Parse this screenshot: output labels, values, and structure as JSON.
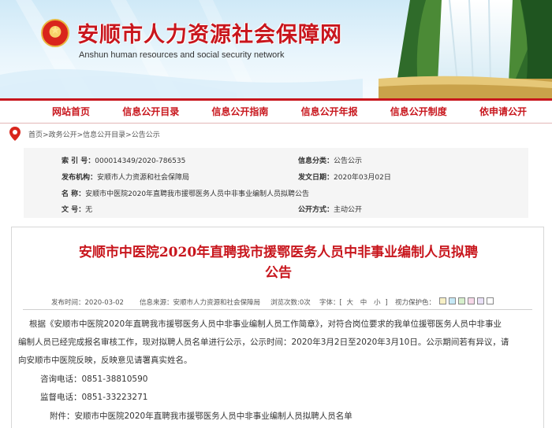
{
  "header": {
    "site_title": "安顺市人力资源社会保障网",
    "site_subtitle": "Anshun human resources and social security network"
  },
  "nav": {
    "items": [
      "网站首页",
      "信息公开目录",
      "信息公开指南",
      "信息公开年报",
      "信息公开制度",
      "依申请公开"
    ]
  },
  "breadcrumb": [
    "首页",
    "政务公开",
    "信息公开目录",
    "公告公示"
  ],
  "meta": {
    "index_label": "索  引  号：",
    "index_value": "000014349/2020-786535",
    "category_label": "信息分类：",
    "category_value": "公告公示",
    "org_label": "发布机构：",
    "org_value": "安顺市人力资源和社会保障局",
    "date_label": "发文日期：",
    "date_value": "2020年03月02日",
    "name_label": "名        称：",
    "name_value": "安顺市中医院2020年直聘我市援鄂医务人员中非事业编制人员拟聘公告",
    "doc_label": "文        号：",
    "doc_value": "无",
    "mode_label": "公开方式：",
    "mode_value": "主动公开"
  },
  "article": {
    "title_line1": "安顺市中医院2020年直聘我市援鄂医务人员中非事业编制人员拟聘",
    "title_line2": "公告",
    "publish_time": "发布时间：2020-03-02",
    "source": "信息来源：安顺市人力资源和社会保障局",
    "views": "浏览次数:0次",
    "font_label": "字体：[",
    "font_large": "大",
    "font_medium": "中",
    "font_small": "小",
    "font_close": "]",
    "eye_label": "视力保护色：",
    "eye_colors": [
      "#f7f0c6",
      "#c6e9f7",
      "#d7f0cc",
      "#f7d7e9",
      "#e9e0f7",
      "#ffffff"
    ],
    "para1_l1": "根据《安顺市中医院2020年直聘我市援鄂医务人员中非事业编制人员工作简章》，对符合岗位要求的我单位援鄂医务人员中非事业",
    "para1_l2": "编制人员已经完成报名审核工作，现对拟聘人员名单进行公示，公示时间：2020年3月2日至2020年3月10日。公示期间若有异议，请",
    "para1_l3": "向安顺市中医院反映，反映意见请署真实姓名。",
    "consult": "咨询电话：0851-38810590",
    "supervise": "监督电话：0851-33223271",
    "attachment": "附件：安顺市中医院2020年直聘我市援鄂医务人员中非事业编制人员拟聘人员名单"
  }
}
